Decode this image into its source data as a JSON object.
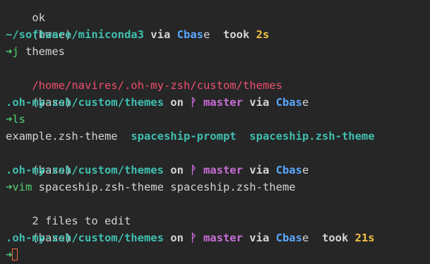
{
  "terminal": {
    "lines": [
      {
        "type": "partial",
        "text": "ok"
      },
      {
        "type": "plain",
        "text": "(base)"
      },
      {
        "type": "prompt",
        "path": "~/software/miniconda3",
        "via": " via ",
        "conda_icon": "C",
        "env_head": "bas",
        "env_tail": "e",
        "took": "  took ",
        "duration": "2s"
      },
      {
        "type": "command",
        "arrow": "➜",
        "cmd": "j",
        "args": " themes"
      },
      {
        "type": "error",
        "text": "/home/navires/.oh-my-zsh/custom/themes"
      },
      {
        "type": "plain",
        "text": "(base)"
      },
      {
        "type": "git-prompt",
        "path": ".oh-my-zsh/custom/themes",
        "on": " on ",
        "git_icon": "ᚹ",
        "branch": "master",
        "via": " via ",
        "conda_icon": "C",
        "env_head": "bas",
        "env_tail": "e"
      },
      {
        "type": "command",
        "arrow": "➜",
        "cmd": "ls",
        "args": ""
      },
      {
        "type": "listing",
        "items": [
          "example.zsh-theme",
          "spaceship-prompt",
          "spaceship.zsh-theme"
        ]
      },
      {
        "type": "plain",
        "text": "(base)"
      },
      {
        "type": "git-prompt",
        "path": ".oh-my-zsh/custom/themes",
        "on": " on ",
        "git_icon": "ᚹ",
        "branch": "master",
        "via": " via ",
        "conda_icon": "C",
        "env_head": "bas",
        "env_tail": "e"
      },
      {
        "type": "command",
        "arrow": "➜",
        "cmd": "vim",
        "args": " spaceship.zsh-theme spaceship.zsh-theme"
      },
      {
        "type": "plain",
        "text": "2 files to edit"
      },
      {
        "type": "plain",
        "text": "(base)"
      },
      {
        "type": "git-prompt-took",
        "path": ".oh-my-zsh/custom/themes",
        "on": " on ",
        "git_icon": "ᚹ",
        "branch": "master",
        "via": " via ",
        "conda_icon": "C",
        "env_head": "bas",
        "env_tail": "e",
        "took": "  took ",
        "duration": "21s"
      },
      {
        "type": "input",
        "arrow": "➜"
      }
    ]
  }
}
